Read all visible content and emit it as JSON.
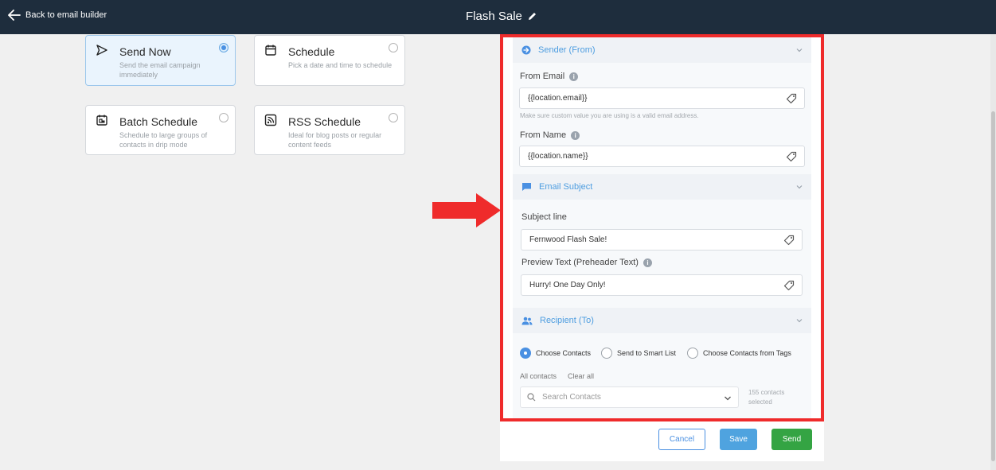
{
  "header": {
    "back_label": "Back to email builder",
    "title": "Flash Sale"
  },
  "schedule_options": [
    {
      "title": "Send Now",
      "desc": "Send the email campaign immediately",
      "selected": true
    },
    {
      "title": "Schedule",
      "desc": "Pick a date and time to schedule",
      "selected": false
    },
    {
      "title": "Batch Schedule",
      "desc": "Schedule to large groups of contacts in drip mode",
      "selected": false
    },
    {
      "title": "RSS Schedule",
      "desc": "Ideal for blog posts or regular content feeds",
      "selected": false
    }
  ],
  "sender": {
    "heading": "Sender (From)",
    "from_email_label": "From Email",
    "from_email_value": "{{location.email}}",
    "from_email_hint": "Make sure custom value you are using is a valid email address.",
    "from_name_label": "From Name",
    "from_name_value": "{{location.name}}"
  },
  "subject": {
    "heading": "Email Subject",
    "subject_label": "Subject line",
    "subject_value": "Fernwood Flash Sale!",
    "preview_label": "Preview Text (Preheader Text)",
    "preview_value": "Hurry! One Day Only!"
  },
  "recipient": {
    "heading": "Recipient (To)",
    "options": [
      {
        "label": "Choose Contacts",
        "selected": true
      },
      {
        "label": "Send to Smart List",
        "selected": false
      },
      {
        "label": "Choose Contacts from Tags",
        "selected": false
      }
    ],
    "all_contacts": "All contacts",
    "clear_all": "Clear all",
    "search_placeholder": "Search Contacts",
    "count_text": "155 contacts selected"
  },
  "footer": {
    "cancel": "Cancel",
    "save": "Save",
    "send": "Send"
  },
  "colors": {
    "topbar": "#1e2d3d",
    "accent": "#4a90e2",
    "highlight_frame": "#ef2b2b",
    "send_button": "#34a443"
  }
}
